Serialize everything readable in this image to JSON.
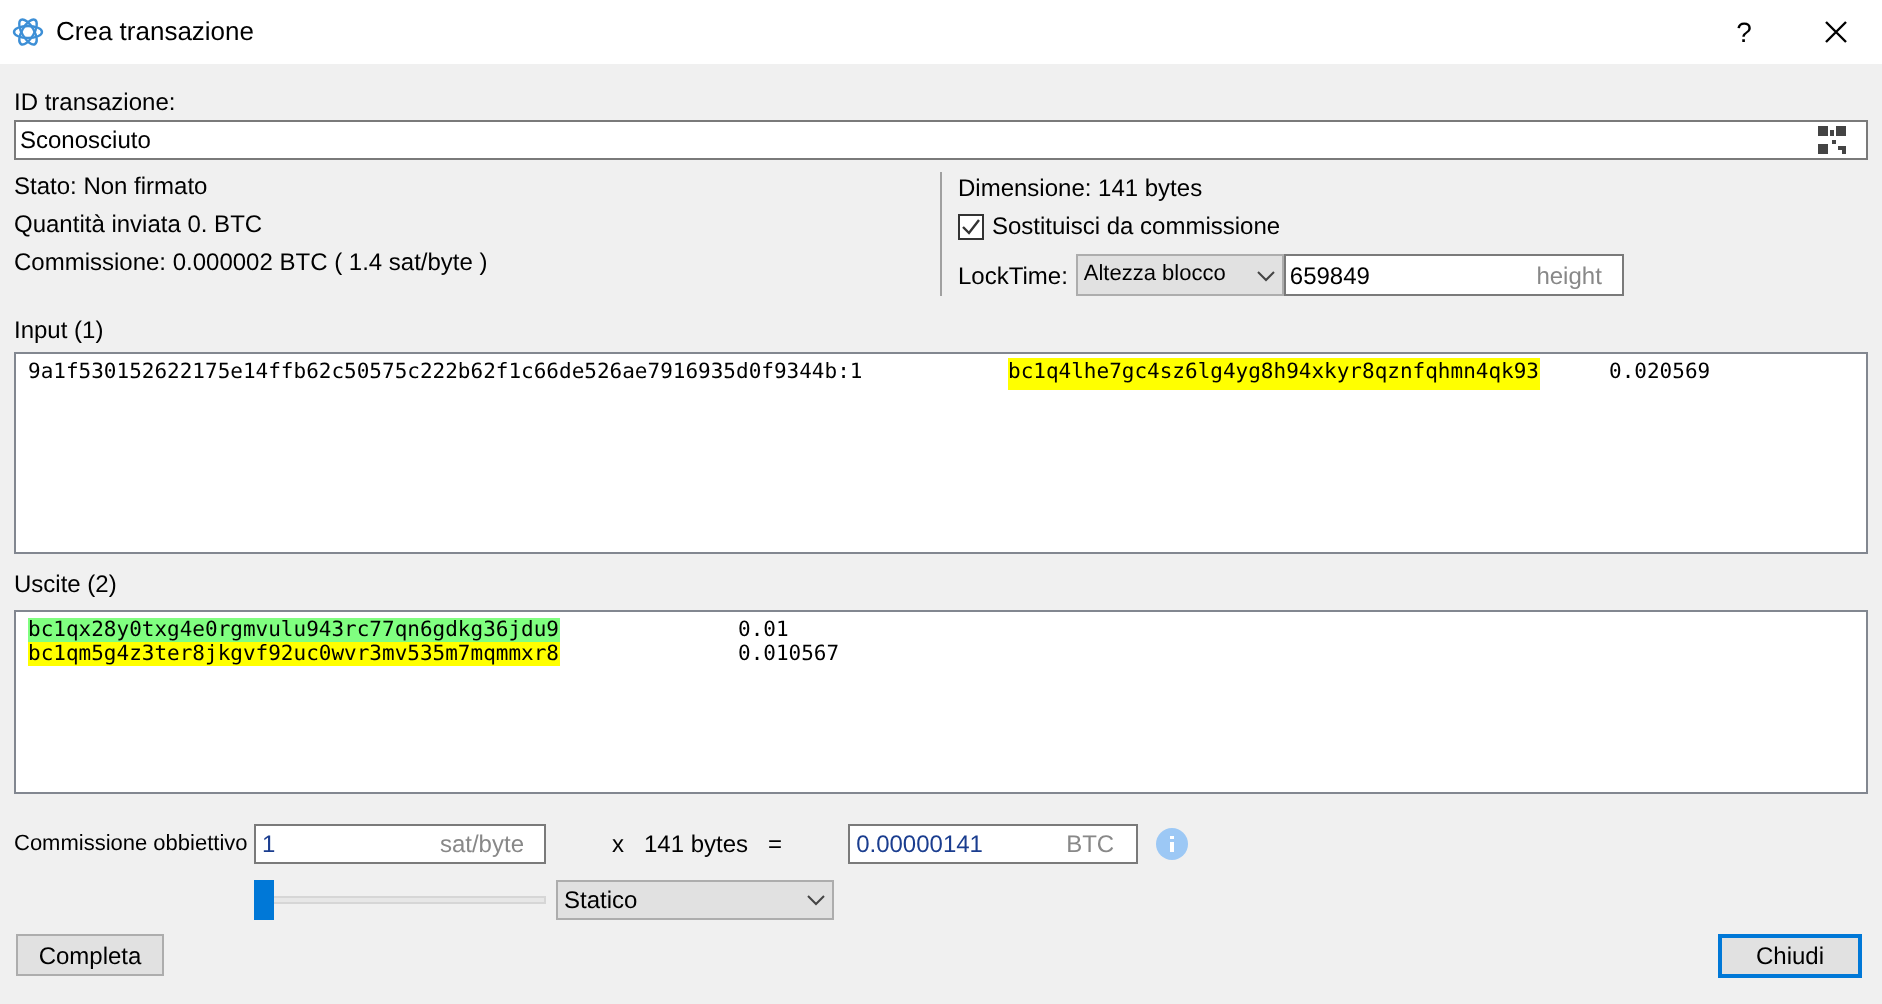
{
  "window": {
    "title": "Crea transazione",
    "help": "?"
  },
  "txid": {
    "label": "ID transazione:",
    "value": "Sconosciuto"
  },
  "info_left": [
    "Stato: Non firmato",
    "Quantità inviata 0. BTC",
    "Commissione: 0.000002 BTC  ( 1.4 sat/byte )"
  ],
  "info_right": {
    "size": "Dimensione: 141 bytes",
    "rbf": {
      "label": "Sostituisci da commissione",
      "checked": true
    },
    "locktime": {
      "label": "LockTime:",
      "type": "Altezza blocco",
      "value": "659849",
      "unit": "height"
    }
  },
  "inputs": {
    "label": "Input (1)",
    "rows": [
      {
        "outpoint": "9a1f530152622175e14ffb62c50575c222b62f1c66de526ae7916935d0f9344b:1",
        "address": "bc1q4lhe7gc4sz6lg4yg8h94xkyr8qznfqhmn4qk93",
        "color": "#ffff00",
        "amount": "0.020569"
      }
    ]
  },
  "outputs": {
    "label": "Uscite (2)",
    "rows": [
      {
        "address": "bc1qx28y0txg4e0rgmvulu943rc77qn6gdkg36jdu9",
        "color": "#80ff80",
        "amount": "0.01"
      },
      {
        "address": "bc1qm5g4z3ter8jkgvf92uc0wvr3mv535m7mqmmxr8",
        "color": "#ffff00",
        "amount": "0.010567"
      }
    ]
  },
  "fee": {
    "label": "Commissione obbiettivo",
    "rate": "1",
    "rate_unit": "sat/byte",
    "times": "x",
    "size": "141 bytes",
    "equals": "=",
    "total": "0.00000141",
    "total_unit": "BTC",
    "slider": {
      "level": 0
    },
    "mode": "Statico"
  },
  "buttons": {
    "left": "Completa",
    "right": "Chiudi"
  }
}
